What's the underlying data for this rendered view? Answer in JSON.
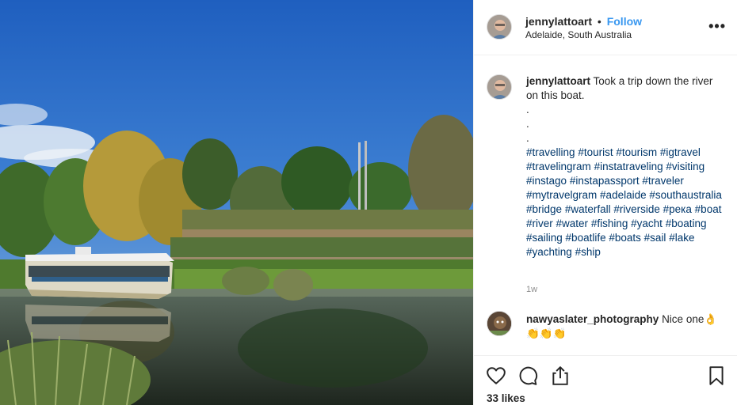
{
  "post": {
    "author": "jennylattoart",
    "separator": "•",
    "follow_label": "Follow",
    "location": "Adelaide, South Australia",
    "more_label": "•••"
  },
  "caption": {
    "author": "jennylattoart",
    "text": "Took a trip down the river on this boat.",
    "dots": [
      ".",
      ".",
      "."
    ],
    "hashtags": [
      "#travelling",
      "#tourist",
      "#tourism",
      "#igtravel",
      "#travelingram",
      "#instatraveling",
      "#visiting",
      "#instago",
      "#instapassport",
      "#traveler",
      "#mytravelgram",
      "#adelaide",
      "#southaustralia",
      "#bridge",
      "#waterfall",
      "#riverside",
      "#река",
      "#boat",
      "#river",
      "#water",
      "#fishing",
      "#yacht",
      "#boating",
      "#sailing",
      "#boatlife",
      "#boats",
      "#sail",
      "#lake",
      "#yachting",
      "#ship"
    ],
    "age": "1w"
  },
  "comment": {
    "author": "nawyaslater_photography",
    "text": "Nice one👌",
    "emoji_line": "👏👏👏"
  },
  "actions": {
    "like_icon": "heart-icon",
    "comment_icon": "speech-bubble-icon",
    "share_icon": "share-icon",
    "save_icon": "bookmark-icon",
    "likes_text": "33 likes"
  },
  "colors": {
    "link": "#3897f0",
    "hashtag": "#00376b",
    "muted": "#8e8e8e",
    "sky": "#2f6fc8"
  }
}
